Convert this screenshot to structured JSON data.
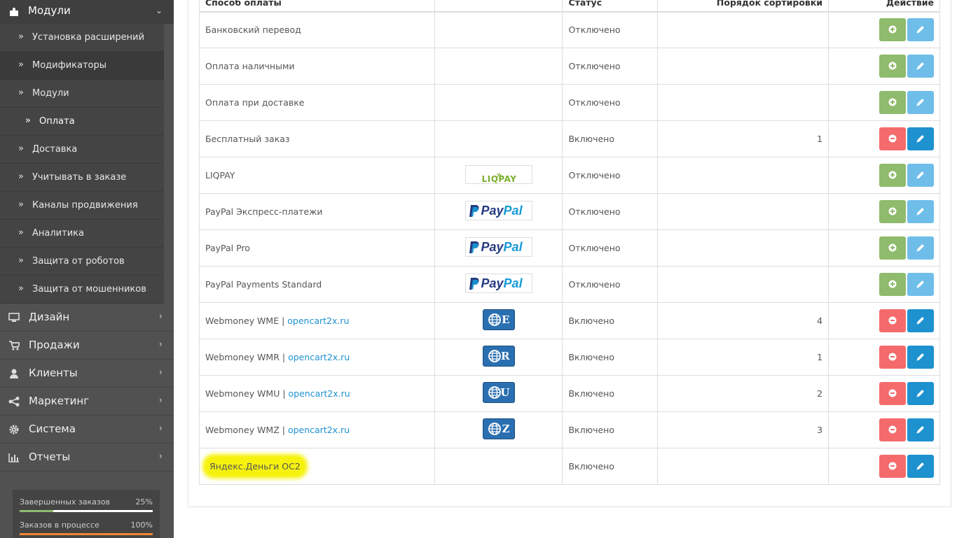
{
  "sidebar": {
    "modules_menu": {
      "label": "Модули",
      "icon": "puzzle-icon"
    },
    "sub_items": [
      {
        "label": "Установка расширений",
        "active": false
      },
      {
        "label": "Модификаторы",
        "active": true
      },
      {
        "label": "Модули",
        "active": false
      },
      {
        "label": "Оплата",
        "active": false
      },
      {
        "label": "Доставка",
        "active": false
      },
      {
        "label": "Учитывать в заказе",
        "active": false
      },
      {
        "label": "Каналы продвижения",
        "active": false
      },
      {
        "label": "Аналитика",
        "active": false
      },
      {
        "label": "Защита от роботов",
        "active": false
      },
      {
        "label": "Защита от мошенников",
        "active": false
      }
    ],
    "main_items": [
      {
        "label": "Дизайн",
        "icon": "monitor-icon"
      },
      {
        "label": "Продажи",
        "icon": "cart-icon"
      },
      {
        "label": "Клиенты",
        "icon": "user-icon"
      },
      {
        "label": "Маркетинг",
        "icon": "share-icon"
      },
      {
        "label": "Система",
        "icon": "gear-icon"
      },
      {
        "label": "Отчеты",
        "icon": "bar-chart-icon"
      }
    ],
    "stats": [
      {
        "label": "Завершенных заказов",
        "percent_text": "25%",
        "value": 0.25,
        "color": "#8fbb6c"
      },
      {
        "label": "Заказов в процессе",
        "percent_text": "100%",
        "value": 1.0,
        "color": "#f38733"
      }
    ]
  },
  "table": {
    "headers": [
      "Способ оплаты",
      "",
      "Статус",
      "Порядок сортировки",
      "Действие"
    ],
    "rows": [
      {
        "name": "Банковский перевод",
        "logo": "",
        "status": "Отключено",
        "sort": "",
        "installed": false
      },
      {
        "name": "Оплата наличными",
        "logo": "",
        "status": "Отключено",
        "sort": "",
        "installed": false
      },
      {
        "name": "Оплата при доставке",
        "logo": "",
        "status": "Отключено",
        "sort": "",
        "installed": false
      },
      {
        "name": "Бесплатный заказ",
        "logo": "",
        "status": "Включено",
        "sort": "1",
        "installed": true
      },
      {
        "name": "LIQPAY",
        "logo": "liqpay",
        "logo_text": "LIQPAY",
        "status": "Отключено",
        "sort": "",
        "installed": false
      },
      {
        "name": "PayPal Экспресс-платежи",
        "logo": "paypal",
        "status": "Отключено",
        "sort": "",
        "installed": false
      },
      {
        "name": "PayPal Pro",
        "logo": "paypal",
        "status": "Отключено",
        "sort": "",
        "installed": false
      },
      {
        "name": "PayPal Payments Standard",
        "logo": "paypal",
        "status": "Отключено",
        "sort": "",
        "installed": false
      },
      {
        "name": "Webmoney WME",
        "sep": " | ",
        "link": "opencart2x.ru",
        "logo": "webmoney",
        "logo_letter": "E",
        "status": "Включено",
        "sort": "4",
        "installed": true
      },
      {
        "name": "Webmoney WMR",
        "sep": " | ",
        "link": "opencart2x.ru",
        "logo": "webmoney",
        "logo_letter": "R",
        "status": "Включено",
        "sort": "1",
        "installed": true
      },
      {
        "name": "Webmoney WMU",
        "sep": " | ",
        "link": "opencart2x.ru",
        "logo": "webmoney",
        "logo_letter": "U",
        "status": "Включено",
        "sort": "2",
        "installed": true
      },
      {
        "name": "Webmoney WMZ",
        "sep": " | ",
        "link": "opencart2x.ru",
        "logo": "webmoney",
        "logo_letter": "Z",
        "status": "Включено",
        "sort": "3",
        "installed": true
      },
      {
        "name": "Яндекс.Деньги ОС2",
        "logo": "",
        "status": "Включено",
        "sort": "",
        "installed": true,
        "highlighted": true
      }
    ],
    "paypal_text": {
      "pay": "Pay",
      "pal": "Pal"
    }
  }
}
